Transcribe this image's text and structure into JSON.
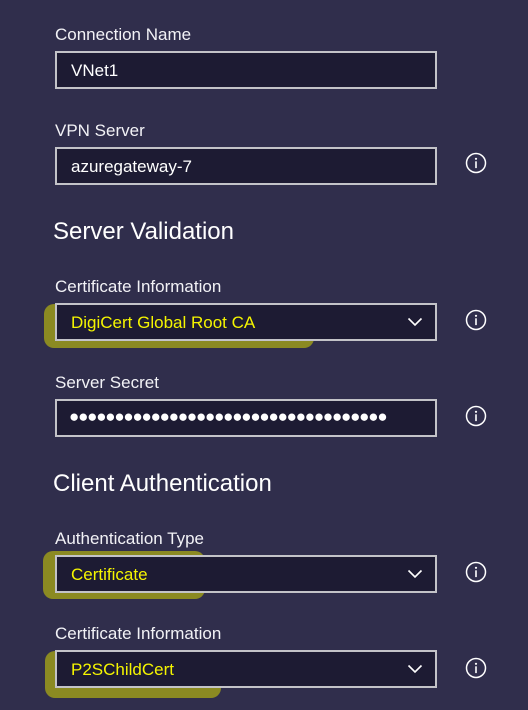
{
  "connection": {
    "name_label": "Connection Name",
    "name_value": "VNet1",
    "server_label": "VPN Server",
    "server_value": "azuregateway-7"
  },
  "server_validation": {
    "title": "Server Validation",
    "cert_info_label": "Certificate Information",
    "cert_info_value": "DigiCert Global Root CA",
    "secret_label": "Server Secret",
    "secret_value": "●●●●●●●●●●●●●●●●●●●●●●●●●●●●●●●●●●●"
  },
  "client_authentication": {
    "title": "Client Authentication",
    "auth_type_label": "Authentication Type",
    "auth_type_value": "Certificate",
    "cert_info_label": "Certificate Information",
    "cert_info_value": "P2SChildCert"
  },
  "icons": {
    "info": "info-icon",
    "dropdown": "chevron-down-icon"
  },
  "colors": {
    "background": "#302e4c",
    "field_background": "#1d1b33",
    "field_border": "#c3c3c8",
    "highlight": "#d7d700"
  }
}
